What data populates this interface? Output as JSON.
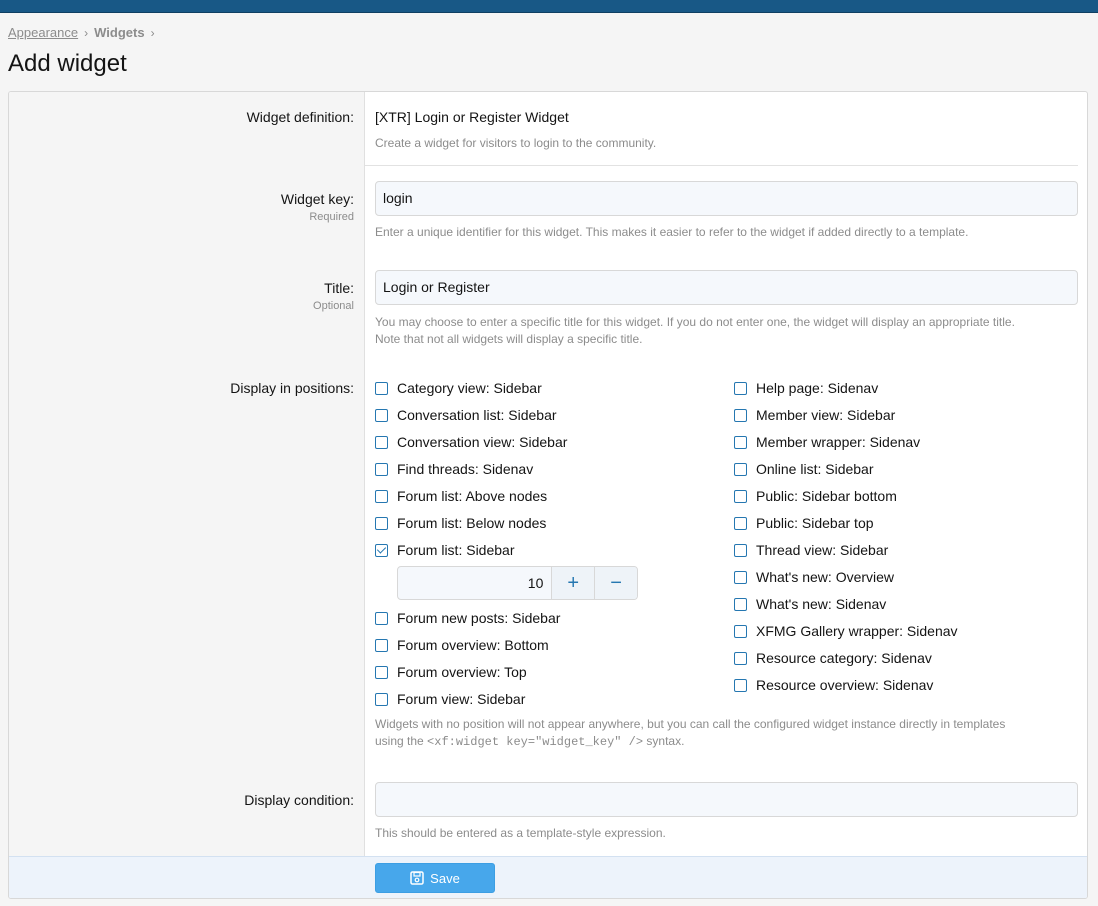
{
  "breadcrumb": [
    "Appearance",
    "Widgets"
  ],
  "page_title": "Add widget",
  "definition": {
    "label": "Widget definition:",
    "value": "[XTR] Login or Register Widget",
    "explain": "Create a widget for visitors to login to the community."
  },
  "widget_key": {
    "label": "Widget key:",
    "hint": "Required",
    "value": "login",
    "explain": "Enter a unique identifier for this widget. This makes it easier to refer to the widget if added directly to a template."
  },
  "title_field": {
    "label": "Title:",
    "hint": "Optional",
    "value": "Login or Register",
    "explain_1": "You may choose to enter a specific title for this widget. If you do not enter one, the widget will display an appropriate title.",
    "explain_2": "Note that not all widgets will display a specific title."
  },
  "positions": {
    "label": "Display in positions:",
    "left": [
      {
        "label": "Category view: Sidebar",
        "checked": false
      },
      {
        "label": "Conversation list: Sidebar",
        "checked": false
      },
      {
        "label": "Conversation view: Sidebar",
        "checked": false
      },
      {
        "label": "Find threads: Sidenav",
        "checked": false
      },
      {
        "label": "Forum list: Above nodes",
        "checked": false
      },
      {
        "label": "Forum list: Below nodes",
        "checked": false
      },
      {
        "label": "Forum list: Sidebar",
        "checked": true
      },
      {
        "label": "Forum new posts: Sidebar",
        "checked": false
      },
      {
        "label": "Forum overview: Bottom",
        "checked": false
      },
      {
        "label": "Forum overview: Top",
        "checked": false
      },
      {
        "label": "Forum view: Sidebar",
        "checked": false
      }
    ],
    "right": [
      {
        "label": "Help page: Sidenav",
        "checked": false
      },
      {
        "label": "Member view: Sidebar",
        "checked": false
      },
      {
        "label": "Member wrapper: Sidenav",
        "checked": false
      },
      {
        "label": "Online list: Sidebar",
        "checked": false
      },
      {
        "label": "Public: Sidebar bottom",
        "checked": false
      },
      {
        "label": "Public: Sidebar top",
        "checked": false
      },
      {
        "label": "Thread view: Sidebar",
        "checked": false
      },
      {
        "label": "What's new: Overview",
        "checked": false
      },
      {
        "label": "What's new: Sidenav",
        "checked": false
      },
      {
        "label": "XFMG Gallery wrapper: Sidenav",
        "checked": false
      },
      {
        "label": "Resource category: Sidenav",
        "checked": false
      },
      {
        "label": "Resource overview: Sidenav",
        "checked": false
      }
    ],
    "order_value": "10",
    "plus": "+",
    "minus": "−",
    "explain_1": "Widgets with no position will not appear anywhere, but you can call the configured widget instance directly in templates",
    "explain_2a": "using the ",
    "explain_code": "<xf:widget key=\"widget_key\" />",
    "explain_2b": " syntax."
  },
  "condition": {
    "label": "Display condition:",
    "value": "",
    "explain": "This should be entered as a template-style expression."
  },
  "save_label": "Save",
  "colors": {
    "accent": "#2577b1",
    "header": "#185886",
    "button": "#47a7eb"
  }
}
